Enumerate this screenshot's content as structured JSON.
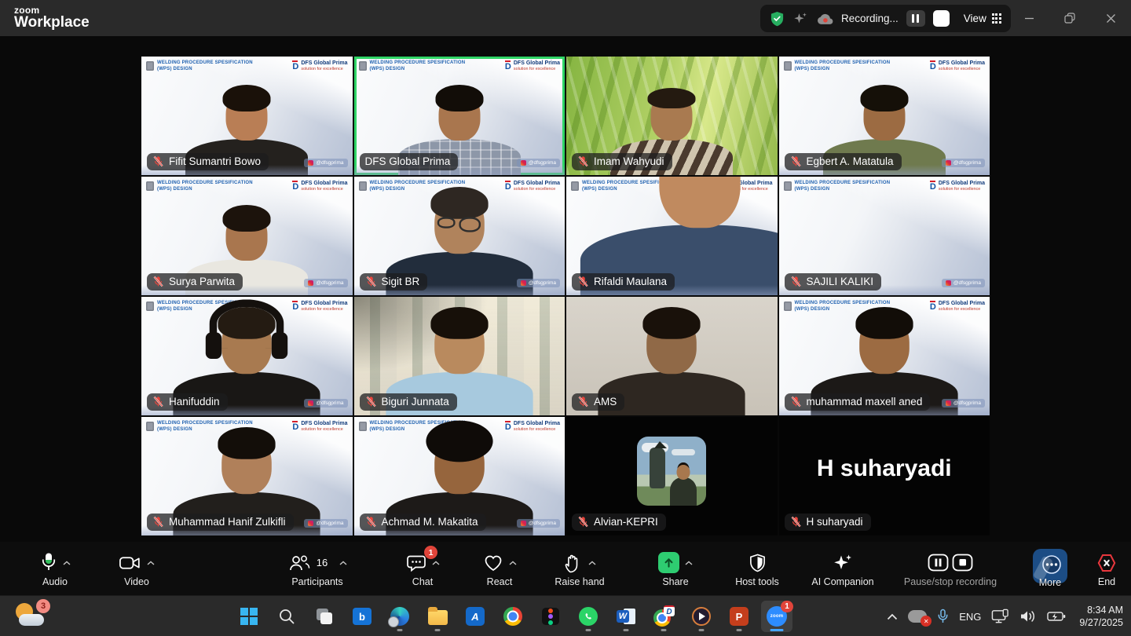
{
  "app": {
    "brand_top": "zoom",
    "brand_bottom": "Workplace",
    "recording_label": "Recording...",
    "view_label": "View"
  },
  "meeting": {
    "watermark_line1": "WELDING PROCEDURE SPESIFICATION",
    "watermark_line2": "(WPS) DESIGN",
    "brand_name": "DFS Global Prima",
    "brand_tagline": "solution for excellence",
    "social_handle": "@dfsgprima",
    "active_speaker": "DFS Global Prima",
    "participants": [
      {
        "name": "Fifit Sumantri Bowo",
        "muted": true
      },
      {
        "name": "DFS Global Prima",
        "muted": false,
        "active": true
      },
      {
        "name": "Imam Wahyudi",
        "muted": true
      },
      {
        "name": "Egbert A. Matatula",
        "muted": true
      },
      {
        "name": "Surya Parwita",
        "muted": true
      },
      {
        "name": "Sigit BR",
        "muted": true
      },
      {
        "name": "Rifaldi Maulana",
        "muted": true
      },
      {
        "name": "SAJILI KALIKI",
        "muted": true
      },
      {
        "name": "Hanifuddin",
        "muted": true
      },
      {
        "name": "Biguri Junnata",
        "muted": true
      },
      {
        "name": "AMS",
        "muted": true
      },
      {
        "name": "muhammad maxell aned",
        "muted": true
      },
      {
        "name": "Muhammad Hanif Zulkifli",
        "muted": true
      },
      {
        "name": "Achmad M. Makatita",
        "muted": true
      },
      {
        "name": "Alvian-KEPRI",
        "muted": true,
        "camera_off": true
      },
      {
        "name": "H suharyadi",
        "muted": true,
        "camera_off": true
      }
    ]
  },
  "toolbar": {
    "audio": "Audio",
    "video": "Video",
    "participants": "Participants",
    "participants_count": "16",
    "chat": "Chat",
    "chat_badge": "1",
    "react": "React",
    "raise_hand": "Raise hand",
    "share": "Share",
    "host_tools": "Host tools",
    "ai_companion": "AI Companion",
    "pause_stop": "Pause/stop recording",
    "more": "More",
    "end": "End"
  },
  "taskbar": {
    "weather_badge": "3",
    "mail_letter": "b",
    "collab_letter": "A",
    "word_letter": "W",
    "dfs_letter": "D",
    "ppt_letter": "P",
    "zoom_icon_text": "zoom",
    "zoom_badge": "1",
    "language": "ENG",
    "time": "8:34 AM",
    "date": "9/27/2025"
  },
  "colors": {
    "accent_green": "#2fd566",
    "record_red": "#e0443a",
    "share_green": "#2ecc71",
    "end_red": "#e8373d",
    "taskbar_accent": "#46a6ff"
  }
}
